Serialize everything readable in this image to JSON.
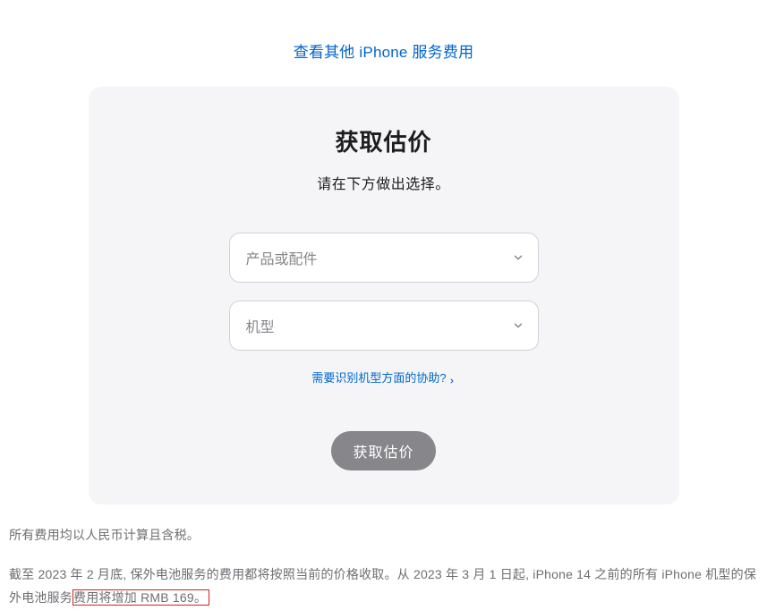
{
  "topLink": {
    "label": "查看其他 iPhone 服务费用"
  },
  "card": {
    "title": "获取估价",
    "subtitle": "请在下方做出选择。",
    "select1": {
      "placeholder": "产品或配件"
    },
    "select2": {
      "placeholder": "机型"
    },
    "helpLink": {
      "label": "需要识别机型方面的协助?"
    },
    "submit": {
      "label": "获取估价"
    }
  },
  "footer": {
    "p1": "所有费用均以人民币计算且含税。",
    "p2_a": "截至 2023 年 2 月底, 保外电池服务的费用都将按照当前的价格收取。从 2023 年 3 月 1 日起, iPhone 14 之前的所有 iPhone 机型的保外电池服务",
    "p2_b": "费用将增加 RMB 169。"
  }
}
